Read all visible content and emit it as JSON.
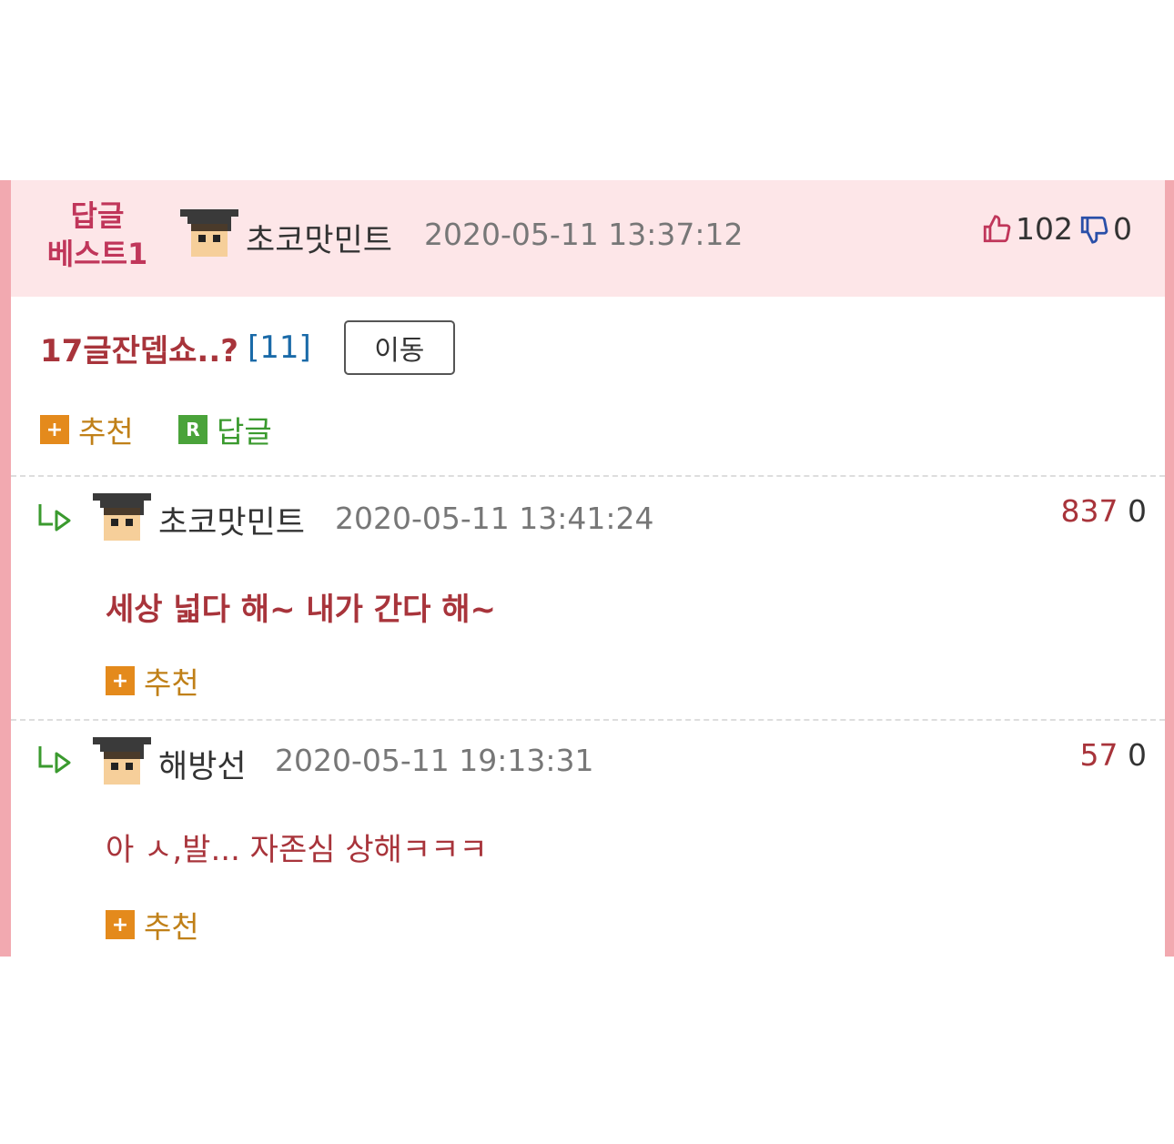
{
  "best_post": {
    "badge_line1": "답글",
    "badge_line2": "베스트1",
    "nickname": "초코맛민트",
    "date": "2020-05-11 13:37:12",
    "likes": "102",
    "dislikes": "0",
    "title": "17글잔뎁쇼..?",
    "reply_count": "[11]",
    "move_label": "이동",
    "recommend_label": "추천",
    "reply_label": "답글",
    "reply_icon_letter": "R",
    "plus_icon": "+"
  },
  "comments": [
    {
      "nickname": "초코맛민트",
      "date": "2020-05-11 13:41:24",
      "up": "837",
      "down": "0",
      "text": "세상 넓다 해~ 내가 간다 해~",
      "recommend_label": "추천",
      "plus_icon": "+"
    },
    {
      "nickname": "해방선",
      "date": "2020-05-11 19:13:31",
      "up": "57",
      "down": "0",
      "text": "아 ㅅ,발... 자존심 상해ㅋㅋㅋ",
      "recommend_label": "추천",
      "plus_icon": "+"
    }
  ],
  "colors": {
    "frame_border": "#f2a9b0",
    "header_bg": "#fde6e8",
    "title_red": "#a8343b",
    "recommend_orange": "#e48a1c",
    "reply_green": "#4aa33a"
  }
}
